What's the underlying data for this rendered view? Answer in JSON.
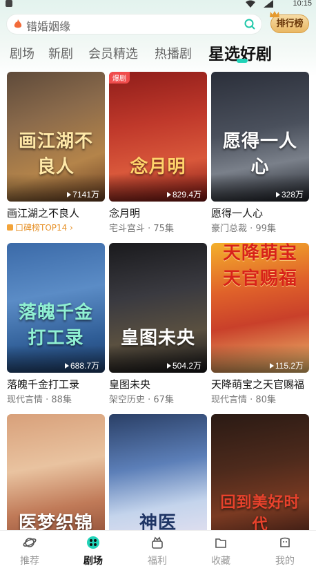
{
  "status_bar": {
    "time": "10:15"
  },
  "search": {
    "text": "错婚姻缘"
  },
  "rank_button": {
    "label": "排行榜"
  },
  "tabs": [
    {
      "label": "剧场"
    },
    {
      "label": "新剧"
    },
    {
      "label": "会员精选"
    },
    {
      "label": "热播剧"
    },
    {
      "label": "星选好剧"
    }
  ],
  "dramas": [
    {
      "title": "画江湖之不良人",
      "poster_text": "画江湖不良人",
      "views": "7141万",
      "rank_label": "口碑榜TOP14",
      "sub": ""
    },
    {
      "title": "念月明",
      "poster_text": "念月明",
      "views": "829.4万",
      "badge": "爆剧",
      "sub": "宅斗宫斗 · 75集"
    },
    {
      "title": "愿得一人心",
      "poster_text": "愿得一人心",
      "views": "328万",
      "sub": "豪门总裁 · 99集"
    },
    {
      "title": "落魄千金打工录",
      "poster_text": "落魄千金打工录",
      "views": "688.7万",
      "sub": "现代言情 · 88集"
    },
    {
      "title": "皇图未央",
      "poster_text": "皇图未央",
      "views": "504.2万",
      "sub": "架空历史 · 67集"
    },
    {
      "title": "天降萌宝之天官赐福",
      "poster_text": "天降萌宝天官赐福",
      "views": "115.2万",
      "sub": "现代言情 · 80集"
    },
    {
      "title": "",
      "poster_text": "医梦织锦",
      "views": "",
      "sub": ""
    },
    {
      "title": "",
      "poster_text": "神医",
      "views": "",
      "sub": ""
    },
    {
      "title": "",
      "poster_text": "回到美好时代",
      "views": "",
      "sub": ""
    }
  ],
  "bottom_nav": [
    {
      "label": "推荐"
    },
    {
      "label": "剧场"
    },
    {
      "label": "福利"
    },
    {
      "label": "收藏"
    },
    {
      "label": "我的"
    }
  ],
  "colors": {
    "accent": "#21d3b8",
    "rank_gold": "#e9b763",
    "hot_badge": "#f04c4c"
  }
}
